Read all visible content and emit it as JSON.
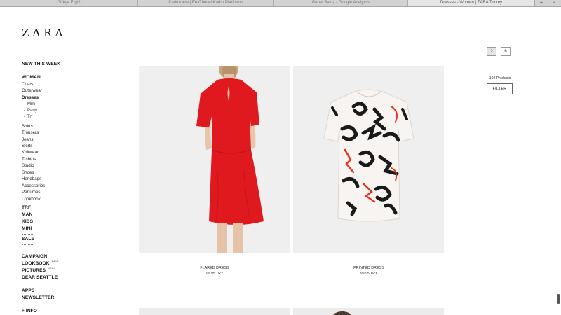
{
  "browser": {
    "tabs": [
      "Gökçe Ergül",
      "Kadınzade | En Güncel Kadın Platformu",
      "Genel Bakış - Google Analytics",
      "Dresses - Women | ZARA Turkey"
    ],
    "new_tab": "+",
    "menu": "≡"
  },
  "brand": "ZARA",
  "sidebar": {
    "new_this_week": "NEW THIS WEEK",
    "woman": "WOMAN",
    "woman_items": [
      "Coats",
      "Outerwear"
    ],
    "dresses": "Dresses",
    "dress_sub": [
      "Mini",
      "Party",
      "Trf"
    ],
    "categories": [
      "Shirts",
      "Trousers",
      "Jeans",
      "Skirts",
      "Knitwear",
      "T-shirts",
      "Studio",
      "Shoes",
      "Handbags",
      "Accessories",
      "Perfumes",
      "Lookbook"
    ],
    "sections": [
      "TRF",
      "MAN",
      "KIDS",
      "MINI"
    ],
    "sale": "SALE",
    "campaign": "CAMPAIGN",
    "lookbook": "LOOKBOOK",
    "pictures": "PICTURES",
    "new_badge": "NEW",
    "dear_seattle": "DEAR SEATTLE",
    "apps": "APPS",
    "newsletter": "NEWSLETTER",
    "info": "+ INFO"
  },
  "grid_options": [
    "2",
    "6"
  ],
  "product_count": "102 Products",
  "filter_label": "FILTER",
  "products": [
    {
      "name": "FLARED DRESS",
      "price": "99.95 TRY"
    },
    {
      "name": "PRINTED DRESS",
      "price": "99.95 TRY"
    }
  ],
  "colors": {
    "red_dress": "#e0191e",
    "print_red": "#e8321f",
    "print_black": "#1a1a1a"
  }
}
